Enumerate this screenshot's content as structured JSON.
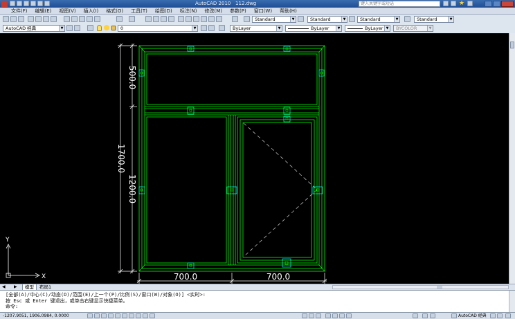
{
  "app": {
    "title": "AutoCAD 2010",
    "file": "112.dwg",
    "search_placeholder": "键入关键字或短语"
  },
  "menu": [
    "文件(F)",
    "编辑(E)",
    "视图(V)",
    "插入(I)",
    "格式(O)",
    "工具(T)",
    "绘图(D)",
    "标注(N)",
    "修改(M)",
    "参数(P)",
    "窗口(W)",
    "帮助(H)"
  ],
  "toolbar": {
    "text_style": "Standard",
    "dim_style": "Standard",
    "table_style": "Standard",
    "multileader_style": "Standard",
    "workspace": "AutoCAD 经典",
    "layer": "0",
    "color": "ByLayer",
    "linetype": "ByLayer",
    "lineweight": "ByLayer",
    "plotstyle": "BYCOLOR"
  },
  "drawing": {
    "dims": {
      "overall_height": "1700.0",
      "top_height": "500.0",
      "bottom_height": "1200.0",
      "left_width": "700.0",
      "right_width": "700.0"
    },
    "ucs": {
      "x": "X",
      "y": "Y"
    }
  },
  "tabs": [
    "模型",
    "布局1"
  ],
  "command": {
    "line1": "[全部(A)/中心(C)/动态(D)/范围(E)/上一个(P)/比例(S)/窗口(W)/对象(O)] <实时>:",
    "line2": "按 Esc 或 Enter 键退出，或单击右键显示快捷菜单。",
    "prompt": "命令:"
  },
  "status": {
    "coords": "-1207.9051, 1906.0984, 0.0000",
    "workspace": "AutoCAD 经典"
  },
  "colors": {
    "frame": "#00ff00",
    "hardware": "#00ffff",
    "dims": "#ffffff",
    "background": "#000000"
  }
}
